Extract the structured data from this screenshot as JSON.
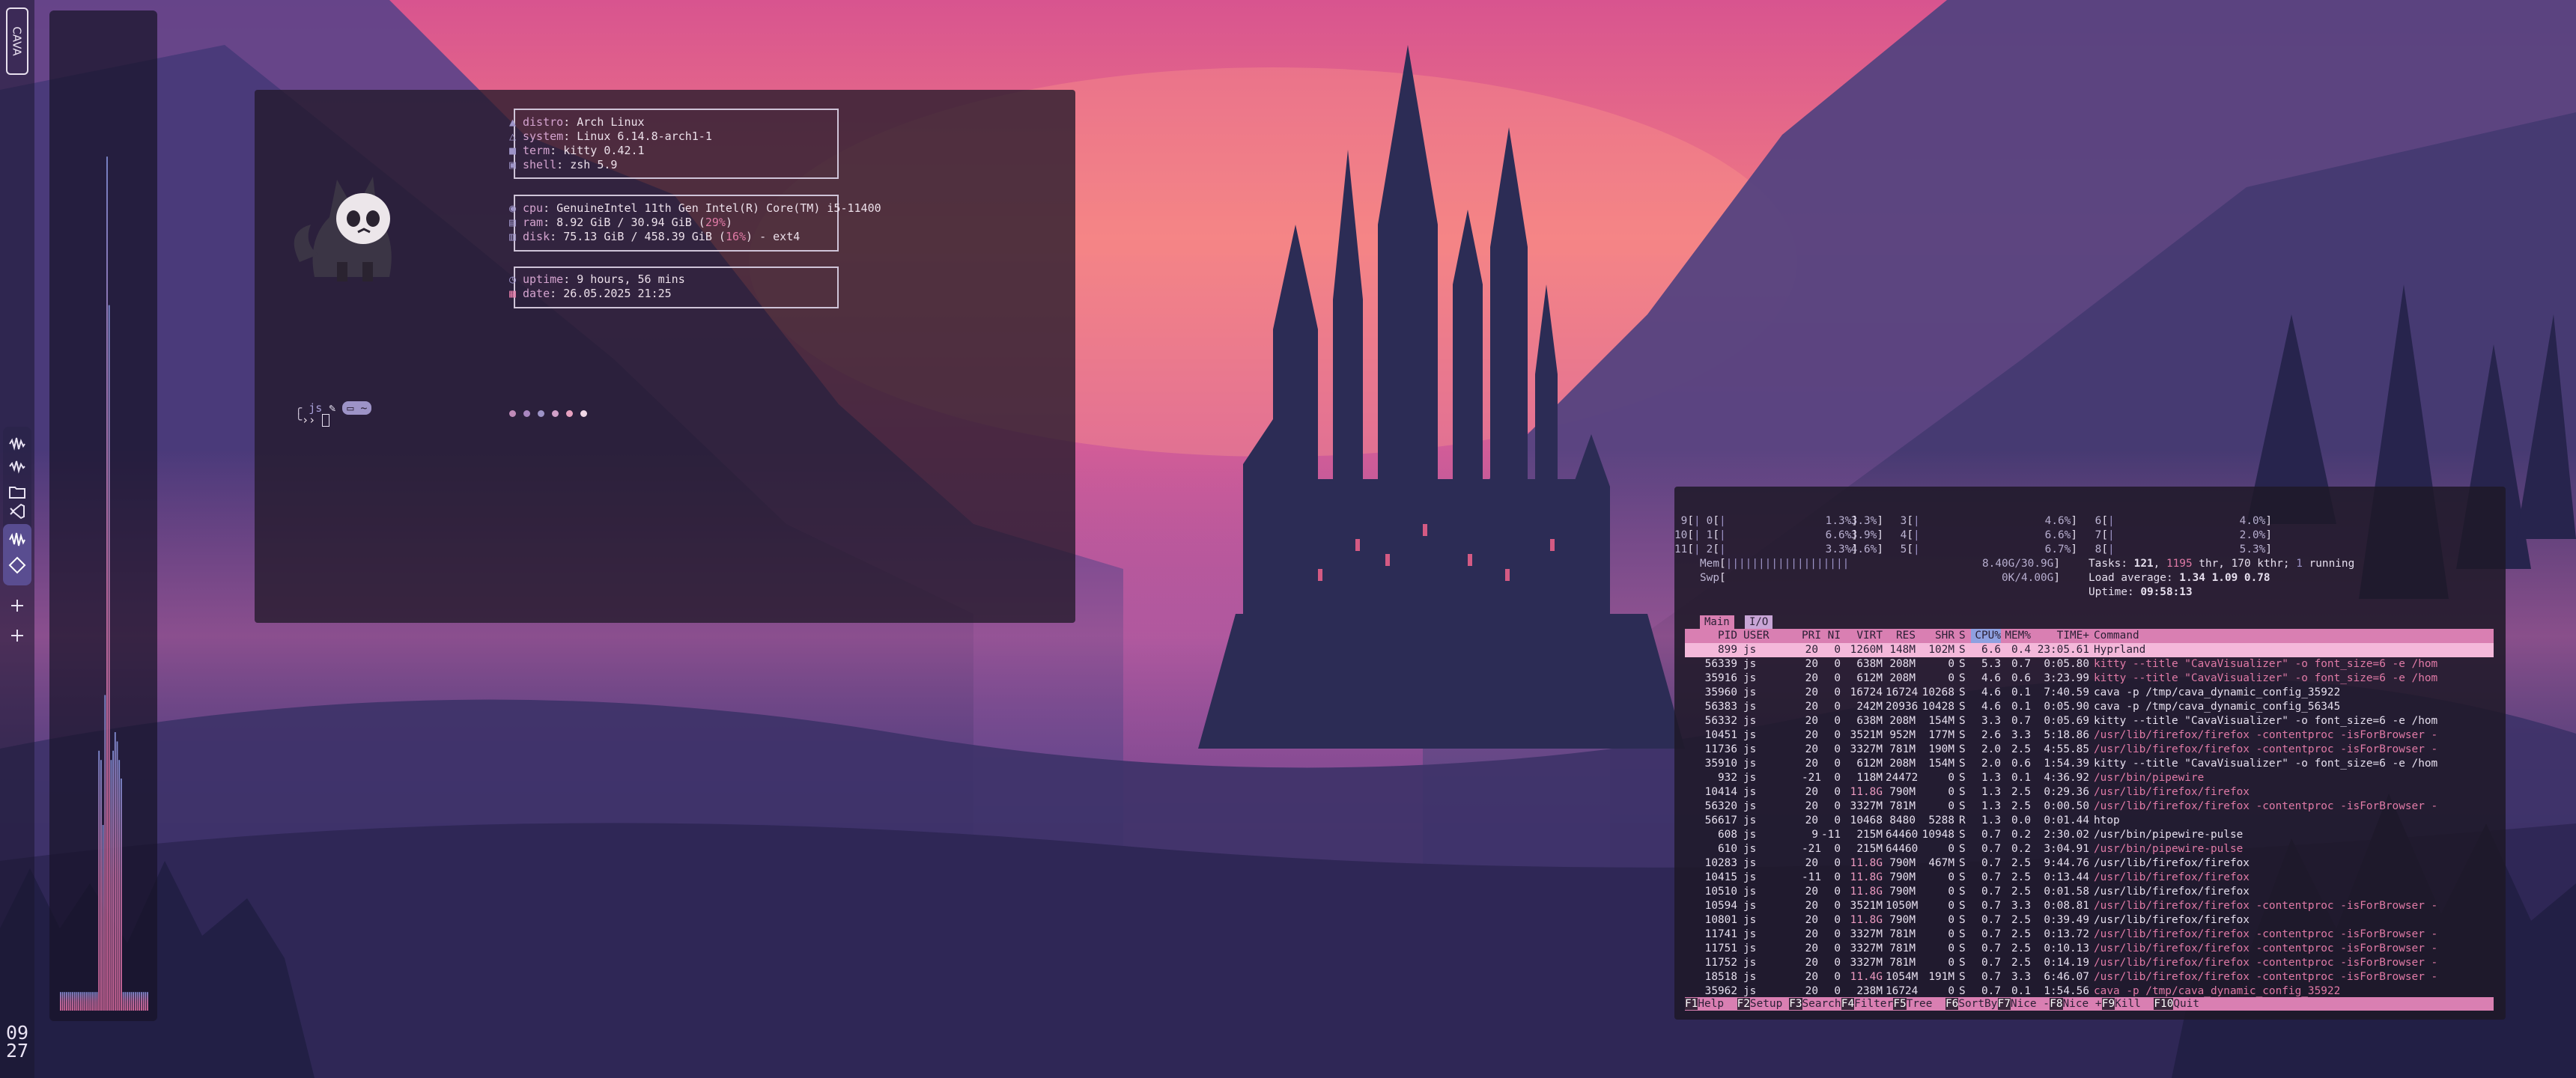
{
  "colors": {
    "accent_pink": "#d97fb2",
    "accent_purple": "#9d93c7",
    "text": "#e6dfee",
    "terminal_bg": "#221a2a"
  },
  "leftbar": {
    "logo_text": "CAVA",
    "workspace_icons": [
      "waveform-icon",
      "waveform-icon",
      "folder-icon",
      "vscode-icon",
      "waveform-icon",
      "vscode-icon",
      "plus-icon",
      "plus-icon"
    ],
    "clock_hour": "09",
    "clock_minute": "27"
  },
  "cava": {
    "bar_levels": [
      0.02,
      0.02,
      0.02,
      0.02,
      0.02,
      0.02,
      0.02,
      0.02,
      0.02,
      0.02,
      0.02,
      0.02,
      0.02,
      0.02,
      0.02,
      0.02,
      0.02,
      0.02,
      0.02,
      0.28,
      0.27,
      0.2,
      0.34,
      0.92,
      0.76,
      0.27,
      0.28,
      0.3,
      0.29,
      0.27,
      0.25,
      0.02,
      0.02,
      0.02,
      0.02,
      0.02,
      0.02,
      0.02,
      0.02,
      0.02,
      0.02,
      0.02,
      0.02,
      0.02
    ]
  },
  "fetch": {
    "distro_label": "distro",
    "distro_value": "Arch Linux",
    "system_label": "system",
    "system_value": "Linux 6.14.8-arch1-1",
    "term_label": "term",
    "term_value": "kitty 0.42.1",
    "shell_label": "shell",
    "shell_value": "zsh 5.9",
    "cpu_label": "cpu",
    "cpu_value": "GenuineIntel 11th Gen Intel(R) Core(TM) i5-11400",
    "ram_label": "ram",
    "ram_value": "8.92 GiB / 30.94 GiB",
    "ram_pct": "29%",
    "disk_label": "disk",
    "disk_value": "75.13 GiB / 458.39 GiB",
    "disk_pct": "16%",
    "disk_suffix": " - ext4",
    "uptime_label": "uptime",
    "uptime_value": "9 hours, 56 mins",
    "date_label": "date",
    "date_value": "26.05.2025 21:25",
    "palette": [
      "#c08ab8",
      "#a986c0",
      "#9d93c7",
      "#d1a0c9",
      "#e7a1c0",
      "#f0d8e6"
    ],
    "prompt_user": "js",
    "prompt_arrow": "›› "
  },
  "htop": {
    "cpus": [
      {
        "id": "0",
        "pct": "3.3%"
      },
      {
        "id": "1",
        "pct": "3.9%"
      },
      {
        "id": "2",
        "pct": "4.6%"
      },
      {
        "id": "3",
        "pct": "4.6%"
      },
      {
        "id": "4",
        "pct": "6.6%"
      },
      {
        "id": "5",
        "pct": "6.7%"
      },
      {
        "id": "6",
        "pct": "4.0%"
      },
      {
        "id": "7",
        "pct": "2.0%"
      },
      {
        "id": "8",
        "pct": "5.3%"
      },
      {
        "id": "9",
        "pct": "1.3%"
      },
      {
        "id": "10",
        "pct": "6.6%"
      },
      {
        "id": "11",
        "pct": "3.3%"
      }
    ],
    "mem_label": "Mem",
    "mem_bar": "|||||||||||||||||||",
    "mem_value": "8.40G/30.9G",
    "swp_label": "Swp",
    "swp_value": "0K/4.00G",
    "tasks_line_a": "Tasks: ",
    "tasks_count": "121",
    "tasks_sep": ", ",
    "tasks_thr": "1195",
    "tasks_line_b": " thr, 170 kthr; ",
    "tasks_running": "1",
    "tasks_line_c": " running",
    "load_label": "Load average: ",
    "load_values": "1.34 1.09 0.78",
    "uptime_label": "Uptime: ",
    "uptime_value": "09:58:13",
    "tab_main": "Main",
    "tab_io": "I/O",
    "headers": [
      "PID",
      "USER",
      "PRI",
      "NI",
      "VIRT",
      "RES",
      "SHR",
      "S",
      "CPU%",
      "MEM%",
      "TIME+",
      "Command"
    ],
    "rows": [
      [
        "899",
        "js",
        "20",
        "0",
        "1260M",
        "148M",
        "102M",
        "S",
        "6.6",
        "0.4",
        "23:05.61",
        "Hyprland"
      ],
      [
        "56339",
        "js",
        "20",
        "0",
        "638M",
        "208M",
        "0",
        "S",
        "5.3",
        "0.7",
        "0:05.80",
        "kitty --title \"CavaVisualizer\" -o font_size=6 -e /hom"
      ],
      [
        "35916",
        "js",
        "20",
        "0",
        "612M",
        "208M",
        "0",
        "S",
        "4.6",
        "0.6",
        "3:23.99",
        "kitty --title \"CavaVisualizer\" -o font_size=6 -e /hom"
      ],
      [
        "35960",
        "js",
        "20",
        "0",
        "16724",
        "16724",
        "10268",
        "S",
        "4.6",
        "0.1",
        "7:40.59",
        "cava -p /tmp/cava_dynamic_config_35922"
      ],
      [
        "56383",
        "js",
        "20",
        "0",
        "242M",
        "20936",
        "10428",
        "S",
        "4.6",
        "0.1",
        "0:05.90",
        "cava -p /tmp/cava_dynamic_config_56345"
      ],
      [
        "56332",
        "js",
        "20",
        "0",
        "638M",
        "208M",
        "154M",
        "S",
        "3.3",
        "0.7",
        "0:05.69",
        "kitty --title \"CavaVisualizer\" -o font_size=6 -e /hom"
      ],
      [
        "10451",
        "js",
        "20",
        "0",
        "3521M",
        "952M",
        "177M",
        "S",
        "2.6",
        "3.3",
        "5:18.86",
        "/usr/lib/firefox/firefox -contentproc -isForBrowser -"
      ],
      [
        "11736",
        "js",
        "20",
        "0",
        "3327M",
        "781M",
        "190M",
        "S",
        "2.0",
        "2.5",
        "4:55.85",
        "/usr/lib/firefox/firefox -contentproc -isForBrowser -"
      ],
      [
        "35910",
        "js",
        "20",
        "0",
        "612M",
        "208M",
        "154M",
        "S",
        "2.0",
        "0.6",
        "1:54.39",
        "kitty --title \"CavaVisualizer\" -o font_size=6 -e /hom"
      ],
      [
        "932",
        "js",
        "-21",
        "0",
        "118M",
        "24472",
        "0",
        "S",
        "1.3",
        "0.1",
        "4:36.92",
        "/usr/bin/pipewire"
      ],
      [
        "10414",
        "js",
        "20",
        "0",
        "11.8G",
        "790M",
        "0",
        "S",
        "1.3",
        "2.5",
        "0:29.36",
        "/usr/lib/firefox/firefox"
      ],
      [
        "56320",
        "js",
        "20",
        "0",
        "3327M",
        "781M",
        "0",
        "S",
        "1.3",
        "2.5",
        "0:00.50",
        "/usr/lib/firefox/firefox -contentproc -isForBrowser -"
      ],
      [
        "56617",
        "js",
        "20",
        "0",
        "10468",
        "8480",
        "5288",
        "R",
        "1.3",
        "0.0",
        "0:01.44",
        "htop"
      ],
      [
        "608",
        "js",
        "9",
        "-11",
        "215M",
        "64460",
        "10948",
        "S",
        "0.7",
        "0.2",
        "2:30.02",
        "/usr/bin/pipewire-pulse"
      ],
      [
        "610",
        "js",
        "-21",
        "0",
        "215M",
        "64460",
        "0",
        "S",
        "0.7",
        "0.2",
        "3:04.91",
        "/usr/bin/pipewire-pulse"
      ],
      [
        "10283",
        "js",
        "20",
        "0",
        "11.8G",
        "790M",
        "467M",
        "S",
        "0.7",
        "2.5",
        "9:44.76",
        "/usr/lib/firefox/firefox"
      ],
      [
        "10415",
        "js",
        "-11",
        "0",
        "11.8G",
        "790M",
        "0",
        "S",
        "0.7",
        "2.5",
        "0:13.44",
        "/usr/lib/firefox/firefox"
      ],
      [
        "10510",
        "js",
        "20",
        "0",
        "11.8G",
        "790M",
        "0",
        "S",
        "0.7",
        "2.5",
        "0:01.58",
        "/usr/lib/firefox/firefox"
      ],
      [
        "10594",
        "js",
        "20",
        "0",
        "3521M",
        "1050M",
        "0",
        "S",
        "0.7",
        "3.3",
        "0:08.81",
        "/usr/lib/firefox/firefox -contentproc -isForBrowser -"
      ],
      [
        "10801",
        "js",
        "20",
        "0",
        "11.8G",
        "790M",
        "0",
        "S",
        "0.7",
        "2.5",
        "0:39.49",
        "/usr/lib/firefox/firefox"
      ],
      [
        "11741",
        "js",
        "20",
        "0",
        "3327M",
        "781M",
        "0",
        "S",
        "0.7",
        "2.5",
        "0:13.72",
        "/usr/lib/firefox/firefox -contentproc -isForBrowser -"
      ],
      [
        "11751",
        "js",
        "20",
        "0",
        "3327M",
        "781M",
        "0",
        "S",
        "0.7",
        "2.5",
        "0:10.13",
        "/usr/lib/firefox/firefox -contentproc -isForBrowser -"
      ],
      [
        "11752",
        "js",
        "20",
        "0",
        "3327M",
        "781M",
        "0",
        "S",
        "0.7",
        "2.5",
        "0:14.19",
        "/usr/lib/firefox/firefox -contentproc -isForBrowser -"
      ],
      [
        "18518",
        "js",
        "20",
        "0",
        "11.4G",
        "1054M",
        "191M",
        "S",
        "0.7",
        "3.3",
        "6:46.07",
        "/usr/lib/firefox/firefox -contentproc -isForBrowser -"
      ],
      [
        "35962",
        "js",
        "20",
        "0",
        "238M",
        "16724",
        "0",
        "S",
        "0.7",
        "0.1",
        "1:54.56",
        "cava -p /tmp/cava_dynamic_config_35922"
      ]
    ],
    "fkeys": [
      {
        "n": "F1",
        "l": "Help"
      },
      {
        "n": "F2",
        "l": "Setup"
      },
      {
        "n": "F3",
        "l": "Search"
      },
      {
        "n": "F4",
        "l": "Filter"
      },
      {
        "n": "F5",
        "l": "Tree"
      },
      {
        "n": "F6",
        "l": "SortBy"
      },
      {
        "n": "F7",
        "l": "Nice -"
      },
      {
        "n": "F8",
        "l": "Nice +"
      },
      {
        "n": "F9",
        "l": "Kill"
      },
      {
        "n": "F10",
        "l": "Quit"
      }
    ]
  }
}
